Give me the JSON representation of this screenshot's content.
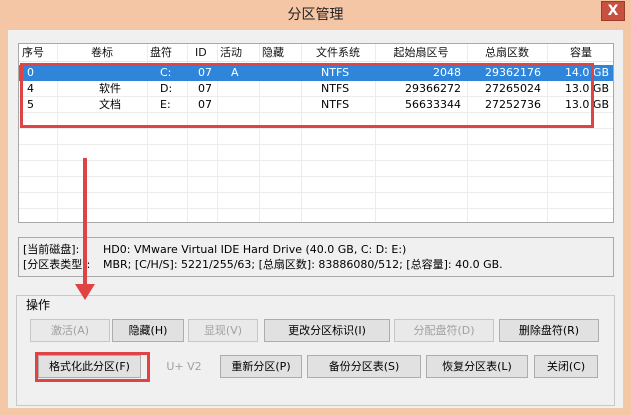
{
  "window": {
    "title": "分区管理",
    "close_label": "X"
  },
  "table": {
    "columns": [
      "序号",
      "卷标",
      "盘符",
      "ID",
      "活动",
      "隐藏",
      "文件系统",
      "起始扇区号",
      "总扇区数",
      "容量"
    ],
    "rows": [
      {
        "index": "0",
        "label": "",
        "letter": "C:",
        "id": "07",
        "active": "A",
        "hidden": "",
        "fs": "NTFS",
        "start": "2048",
        "total": "29362176",
        "size": "14.0 GB",
        "selected": true
      },
      {
        "index": "4",
        "label": "软件",
        "letter": "D:",
        "id": "07",
        "active": "",
        "hidden": "",
        "fs": "NTFS",
        "start": "29366272",
        "total": "27265024",
        "size": "13.0 GB",
        "selected": false
      },
      {
        "index": "5",
        "label": "文档",
        "letter": "E:",
        "id": "07",
        "active": "",
        "hidden": "",
        "fs": "NTFS",
        "start": "56633344",
        "total": "27252736",
        "size": "13.0 GB",
        "selected": false
      }
    ]
  },
  "info": {
    "disk_label": "[当前磁盘]:",
    "disk_value": "HD0: VMware Virtual IDE Hard Drive (40.0 GB, C: D: E:)",
    "ptype_label": "[分区表类型]:",
    "ptype_value": "MBR;      [C/H/S]: 5221/255/63; [总扇区数]: 83886080/512; [总容量]: 40.0 GB."
  },
  "ops": {
    "title": "操作",
    "row1": {
      "activate": "激活(A)",
      "hide": "隐藏(H)",
      "show": "显现(V)",
      "change_id": "更改分区标识(I)",
      "assign_letter": "分配盘符(D)",
      "delete_letter": "删除盘符(R)"
    },
    "row2": {
      "format": "格式化此分区(F)",
      "uv2": "U+ V2",
      "repartition": "重新分区(P)",
      "backup": "备份分区表(S)",
      "restore": "恢复分区表(L)",
      "close": "关闭(C)"
    }
  },
  "colors": {
    "accent": "#2f85d9",
    "highlight": "#e04343",
    "titlebar": "#f5c6a5"
  }
}
